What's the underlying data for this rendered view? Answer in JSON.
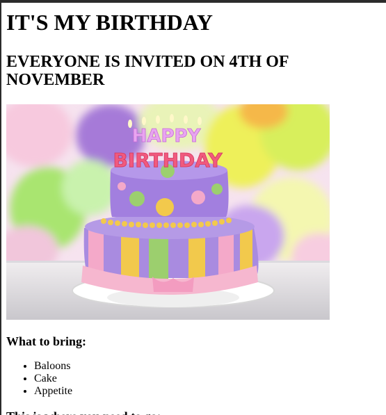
{
  "page": {
    "title": "IT'S MY BIRTHDAY",
    "subtitle": "EVERYONE IS INVITED ON 4TH OF NOVEMBER",
    "image": {
      "cake_topper_line1": "HAPPY",
      "cake_topper_line2": "BIRTHDAY"
    },
    "bring_heading": "What to bring:",
    "bring_items": [
      "Baloons",
      "Cake",
      "Appetite"
    ],
    "directions_heading": "This is where you need to go:"
  },
  "colors": {
    "balloon_purple": "#9b6fd6",
    "balloon_yellow": "#e6ef4a",
    "balloon_green": "#9fe06a",
    "cake_purple": "#a98be0",
    "cake_pink": "#f4a9c9",
    "cake_yellow": "#f2c94c",
    "cake_green": "#9ccf6e"
  }
}
